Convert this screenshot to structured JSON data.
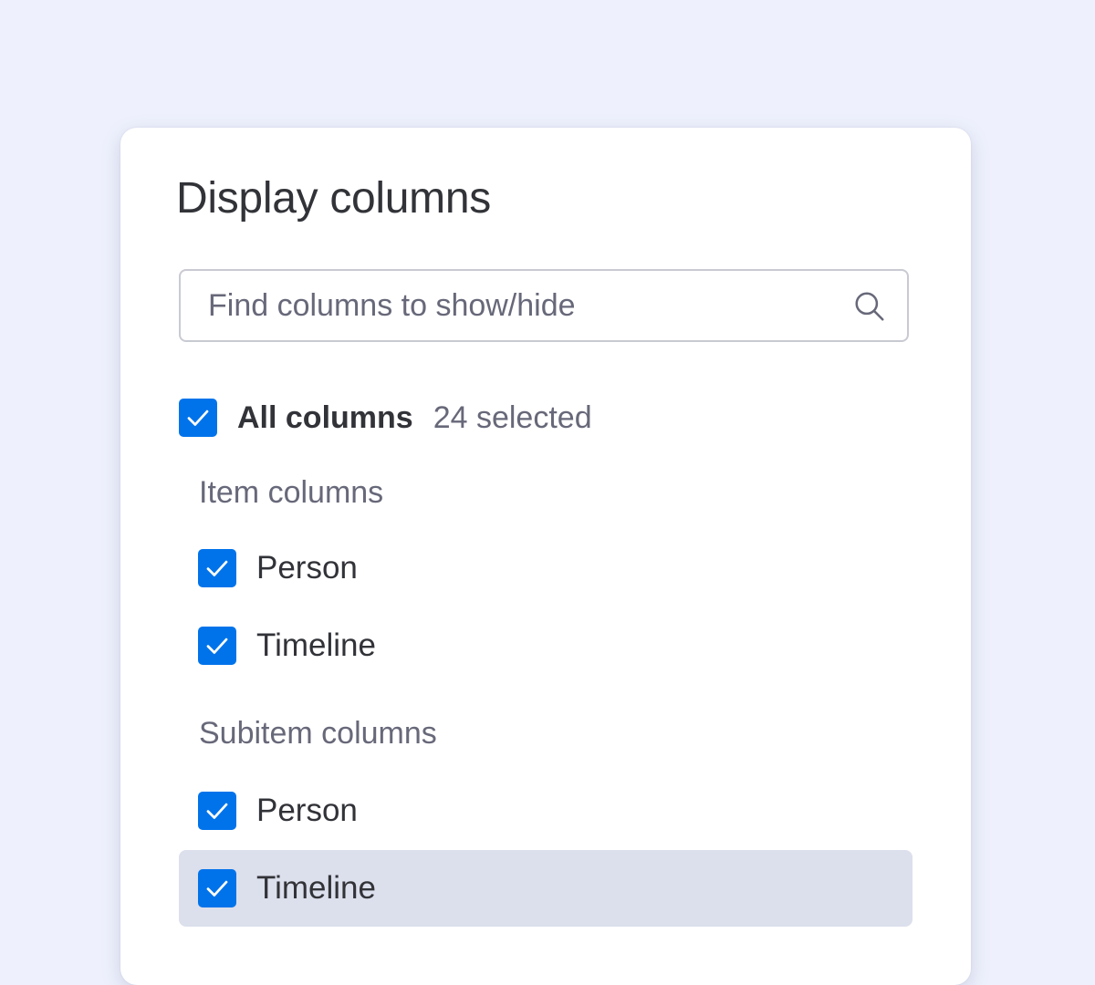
{
  "panel": {
    "title": "Display columns"
  },
  "search": {
    "placeholder": "Find columns to show/hide",
    "value": ""
  },
  "all_columns": {
    "label": "All columns",
    "count_text": "24 selected",
    "checked": true
  },
  "sections": [
    {
      "label": "Item columns",
      "items": [
        {
          "label": "Person",
          "checked": true
        },
        {
          "label": "Timeline",
          "checked": true
        }
      ]
    },
    {
      "label": "Subitem columns",
      "items": [
        {
          "label": "Person",
          "checked": true
        },
        {
          "label": "Timeline",
          "checked": true,
          "highlighted": true
        }
      ]
    }
  ],
  "colors": {
    "accent": "#0073ea",
    "background": "#eef1fd",
    "hover_row": "#dcdfec",
    "text_primary": "#323338",
    "text_secondary": "#676879"
  },
  "icons": {
    "search": "search-icon",
    "check": "checkmark-icon"
  }
}
